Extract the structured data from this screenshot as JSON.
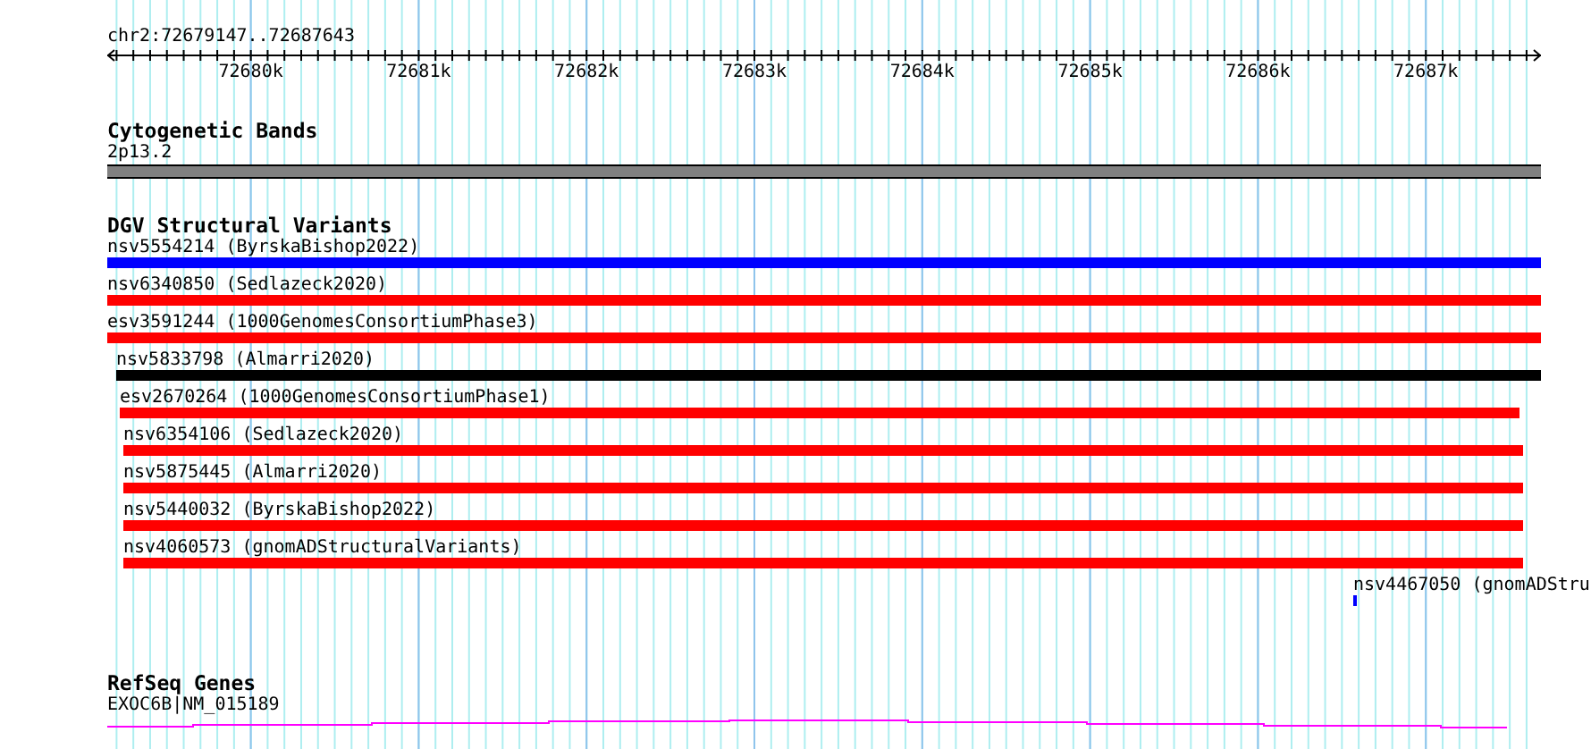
{
  "location": "chr2:72679147..72687643",
  "scale_ticks": [
    "72680k",
    "72681k",
    "72682k",
    "72683k",
    "72684k",
    "72685k",
    "72686k",
    "72687k"
  ],
  "tracks": [
    {
      "title": "Cytogenetic Bands",
      "kind": "bands",
      "features": [
        {
          "label": "2p13.2"
        }
      ]
    },
    {
      "title": "DGV Structural Variants",
      "kind": "variants",
      "features": [
        {
          "label": "nsv5554214 (ByrskaBishop2022)",
          "color": "#0000ff"
        },
        {
          "label": "nsv6340850 (Sedlazeck2020)",
          "color": "#ff0000"
        },
        {
          "label": "esv3591244 (1000GenomesConsortiumPhase3)",
          "color": "#ff0000"
        },
        {
          "label": "nsv5833798 (Almarri2020)",
          "color": "#000000"
        },
        {
          "label": "esv2670264 (1000GenomesConsortiumPhase1)",
          "color": "#ff0000"
        },
        {
          "label": "nsv6354106 (Sedlazeck2020)",
          "color": "#ff0000"
        },
        {
          "label": "nsv5875445 (Almarri2020)",
          "color": "#ff0000"
        },
        {
          "label": "nsv5440032 (ByrskaBishop2022)",
          "color": "#ff0000"
        },
        {
          "label": "nsv4060573 (gnomADStructuralVariants)",
          "color": "#ff0000"
        },
        {
          "label": "nsv4467050 (gnomADStru",
          "color": "#0000ff"
        }
      ]
    },
    {
      "title": "RefSeq Genes",
      "kind": "genes",
      "features": [
        {
          "label": "EXOC6B|NM_015189"
        }
      ]
    }
  ]
}
